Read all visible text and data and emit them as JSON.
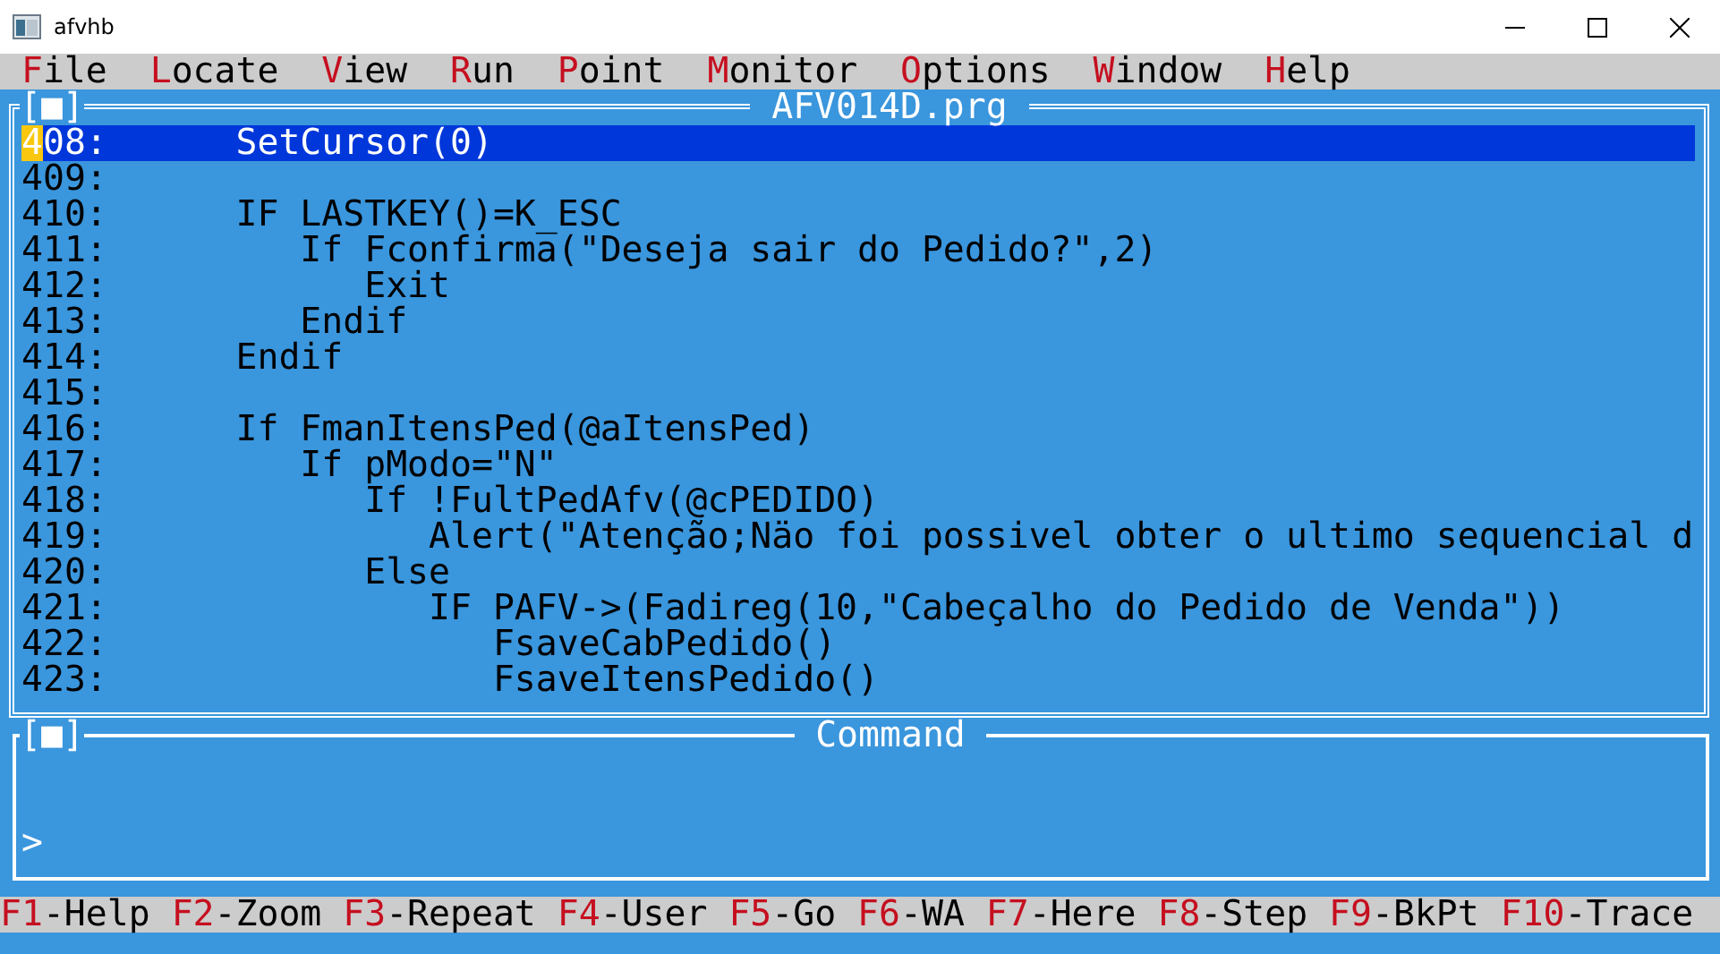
{
  "window": {
    "title": "afvhb"
  },
  "menu": [
    {
      "hotkey": "F",
      "rest": "ile"
    },
    {
      "hotkey": "L",
      "rest": "ocate"
    },
    {
      "hotkey": "V",
      "rest": "iew"
    },
    {
      "hotkey": "R",
      "rest": "un"
    },
    {
      "hotkey": "P",
      "rest": "oint"
    },
    {
      "hotkey": "M",
      "rest": "onitor"
    },
    {
      "hotkey": "O",
      "rest": "ptions"
    },
    {
      "hotkey": "W",
      "rest": "indow"
    },
    {
      "hotkey": "H",
      "rest": "elp"
    }
  ],
  "code_window": {
    "close_box": "[■]",
    "title": "AFV014D.prg",
    "lines": [
      {
        "number": "408:",
        "code": "     SetCursor(0)",
        "selected": true,
        "cursor": true
      },
      {
        "number": "409:",
        "selected": false,
        "cursor": false
      },
      {
        "number": "410:",
        "code": "     IF LASTKEY()=K_ESC",
        "selected": false,
        "cursor": false
      },
      {
        "number": "411:",
        "code": "        If Fconfirma(\"Deseja sair do Pedido?\",2)",
        "selected": false,
        "cursor": false
      },
      {
        "number": "412:",
        "code": "           Exit",
        "selected": false,
        "cursor": false
      },
      {
        "number": "413:",
        "code": "        Endif",
        "selected": false,
        "cursor": false
      },
      {
        "number": "414:",
        "code": "     Endif",
        "selected": false,
        "cursor": false
      },
      {
        "number": "415:",
        "selected": false,
        "cursor": false
      },
      {
        "number": "416:",
        "code": "     If FmanItensPed(@aItensPed)",
        "selected": false,
        "cursor": false
      },
      {
        "number": "417:",
        "code": "        If pModo=\"N\"",
        "selected": false,
        "cursor": false
      },
      {
        "number": "418:",
        "code": "           If !FultPedAfv(@cPEDIDO)",
        "selected": false,
        "cursor": false
      },
      {
        "number": "419:",
        "code": "              Alert(\"Atenção;Näo foi possivel obter o ultimo sequencial d",
        "selected": false,
        "cursor": false
      },
      {
        "number": "420:",
        "code": "           Else",
        "selected": false,
        "cursor": false
      },
      {
        "number": "421:",
        "code": "              IF PAFV->(Fadireg(10,\"Cabeçalho do Pedido de Venda\"))",
        "selected": false,
        "cursor": false
      },
      {
        "number": "422:",
        "code": "                 FsaveCabPedido()",
        "selected": false,
        "cursor": false
      },
      {
        "number": "423:",
        "code": "                 FsaveItensPedido()",
        "selected": false,
        "cursor": false
      }
    ]
  },
  "command_window": {
    "close_box": "[■]",
    "title": "Command",
    "prompt": ">"
  },
  "function_keys": [
    {
      "key": "F1",
      "label": "-Help"
    },
    {
      "key": "F2",
      "label": "-Zoom"
    },
    {
      "key": "F3",
      "label": "-Repeat"
    },
    {
      "key": "F4",
      "label": "-User"
    },
    {
      "key": "F5",
      "label": "-Go"
    },
    {
      "key": "F6",
      "label": "-WA"
    },
    {
      "key": "F7",
      "label": "-Here"
    },
    {
      "key": "F8",
      "label": "-Step"
    },
    {
      "key": "F9",
      "label": "-BkPt"
    },
    {
      "key": "F10",
      "label": "-Trace"
    }
  ]
}
